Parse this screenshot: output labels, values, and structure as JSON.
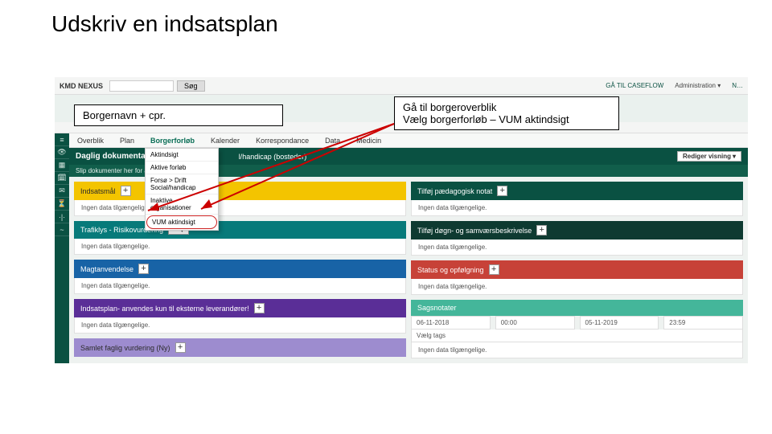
{
  "slide_title": "Udskriv en indsatsplan",
  "callouts": {
    "left": "Borgernavn + cpr.",
    "right_line1": "Gå til borgeroverblik",
    "right_line2": "Vælg borgerforløb – VUM aktindsigt"
  },
  "topbar": {
    "logo": "KMD NEXUS",
    "search_btn": "Søg",
    "caseflow": "GÅ TIL CASEFLOW",
    "admin": "Administration ▾",
    "user": "N…"
  },
  "tabs": {
    "overblik": "Overblik",
    "plan": "Plan",
    "borgerforlob": "Borgerforløb",
    "kalender": "Kalender",
    "korrespondance": "Korrespondance",
    "data": "Data",
    "medicin": "Medicin"
  },
  "dropdown": {
    "aktindsigt": "Aktindsigt",
    "aktive": "Aktive forløb",
    "fors": "Forsø > Drift Social/handicap",
    "inaktive": "Inaktive organisationer",
    "vum": "VUM aktindsigt"
  },
  "dark_strip": {
    "title": "Daglig dokumenta",
    "tail": "l/handicap (bosteder)",
    "btn": "Rediger visning",
    "caret": "▾"
  },
  "sub_strip": "Slip dokumenter her for at gen…",
  "cards": {
    "indsatsmal": "Indsatsmål",
    "trafiklys": "Trafiklys - Risikovurdering",
    "magt": "Magtanvendelse",
    "indsplan": "Indsatsplan- anvendes kun til eksterne leverandører!",
    "samlet": "Samlet faglig vurdering (Ny)",
    "paed": "Tilføj pædagogisk notat",
    "dogn": "Tilføj døgn- og samværsbeskrivelse",
    "status": "Status og opfølgning",
    "sagsnot": "Sagsnotater"
  },
  "empty": "Ingen data tilgængelige.",
  "empty2": "Ingen data tilgængelige.",
  "notes": {
    "d1": "06-11-2018",
    "t1": "00:00",
    "d2": "05-11-2019",
    "t2": "23:59",
    "tags": "Vælg tags"
  }
}
